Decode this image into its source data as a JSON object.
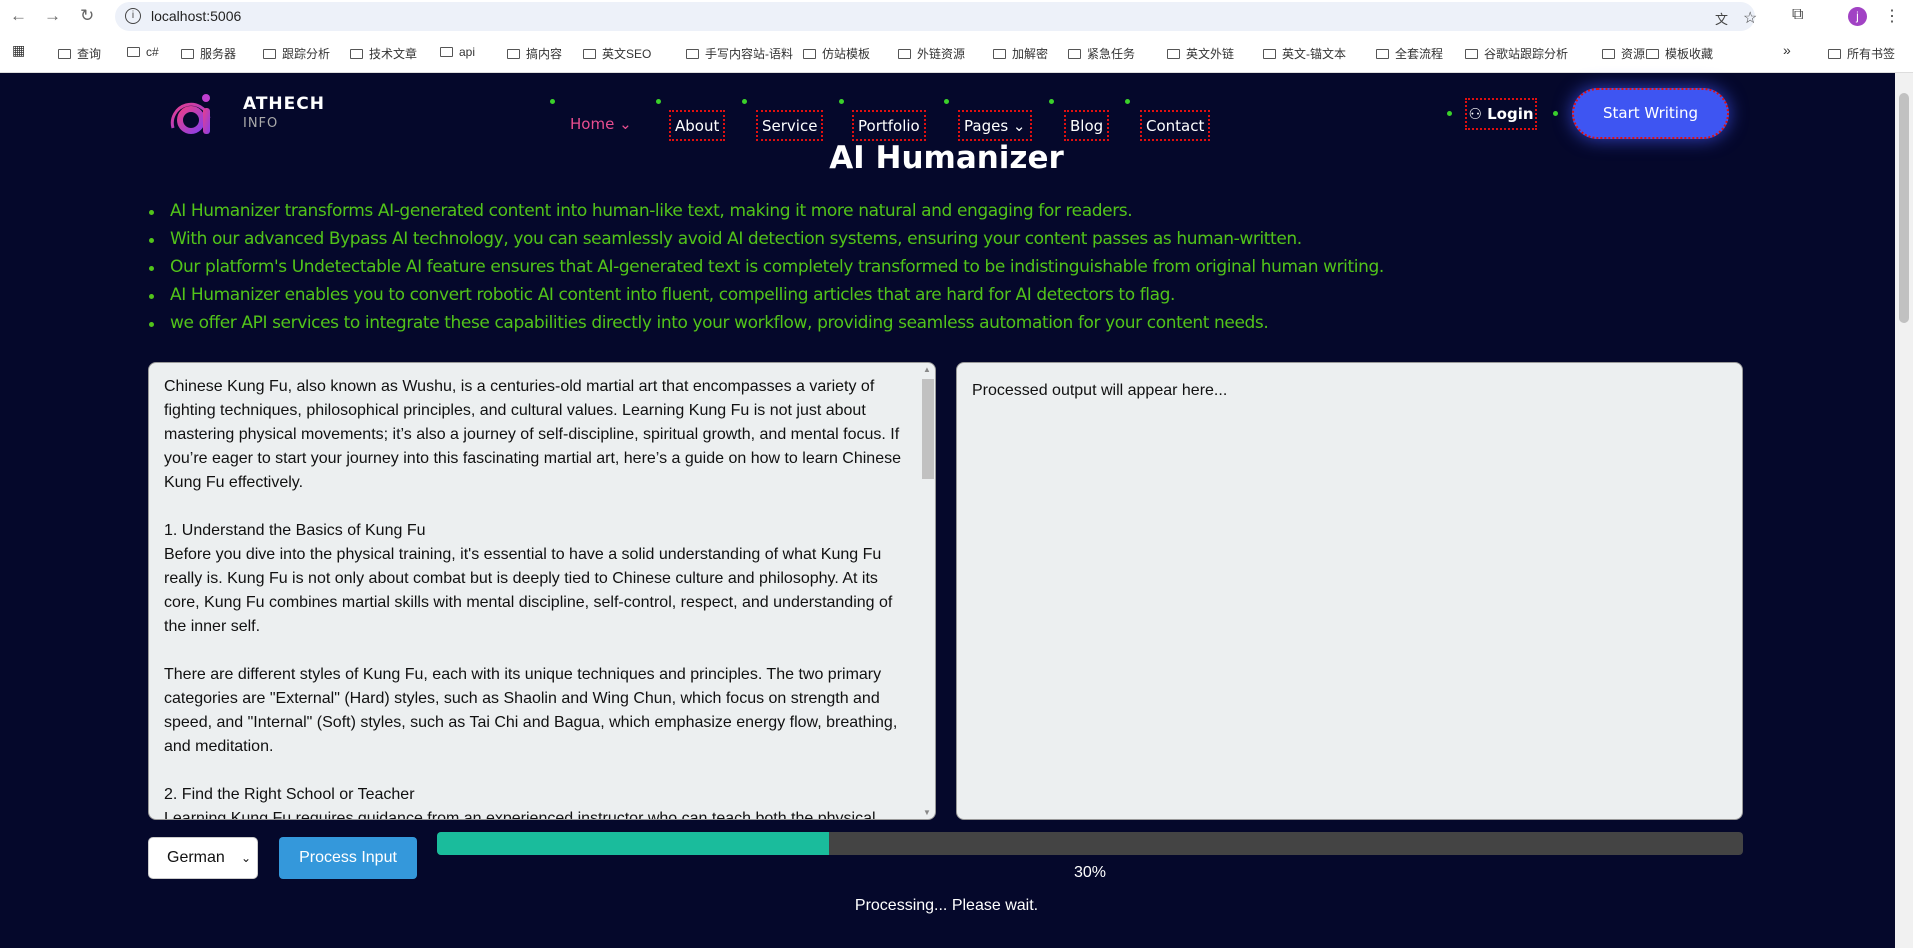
{
  "browser": {
    "url": "localhost:5006",
    "avatar_letter": "j",
    "bookmarks": [
      "查询",
      "c#",
      "服务器",
      "跟踪分析",
      "技术文章",
      "api",
      "搞内容",
      "英文SEO",
      "手写内容站-语料",
      "仿站模板",
      "外链资源",
      "加解密",
      "紧急任务",
      "英文外链",
      "英文-锚文本",
      "全套流程",
      "谷歌站跟踪分析",
      "资源",
      "模板收藏"
    ],
    "more": "»",
    "all_bookmarks": "所有书签"
  },
  "site": {
    "brand": "ATHECH",
    "brand_sub": "INFO",
    "nav": [
      "Home",
      "About",
      "Service",
      "Portfolio",
      "Pages",
      "Blog",
      "Contact"
    ],
    "login": "Login",
    "cta": "Start Writing"
  },
  "main": {
    "title": "AI Humanizer",
    "bullets": [
      "AI Humanizer transforms AI-generated content into human-like text, making it more natural and engaging for readers.",
      "With our advanced Bypass AI technology, you can seamlessly avoid AI detection systems, ensuring your content passes as human-written.",
      "Our platform's Undetectable AI feature ensures that AI-generated text is completely transformed to be indistinguishable from original human writing.",
      "AI Humanizer enables you to convert robotic AI content into fluent, compelling articles that are hard for AI detectors to flag.",
      "we offer API services to integrate these capabilities directly into your workflow, providing seamless automation for your content needs."
    ],
    "input_text": "Chinese Kung Fu, also known as Wushu, is a centuries-old martial art that encompasses a variety of fighting techniques, philosophical principles, and cultural values. Learning Kung Fu is not just about mastering physical movements; it’s also a journey of self-discipline, spiritual growth, and mental focus. If you’re eager to start your journey into this fascinating martial art, here’s a guide on how to learn Chinese Kung Fu effectively.\n\n1. Understand the Basics of Kung Fu\nBefore you dive into the physical training, it's essential to have a solid understanding of what Kung Fu really is. Kung Fu is not only about combat but is deeply tied to Chinese culture and philosophy. At its core, Kung Fu combines martial skills with mental discipline, self-control, respect, and understanding of the inner self.\n\nThere are different styles of Kung Fu, each with its unique techniques and principles. The two primary categories are \"External\" (Hard) styles, such as Shaolin and Wing Chun, which focus on strength and speed, and \"Internal\" (Soft) styles, such as Tai Chi and Bagua, which emphasize energy flow, breathing, and meditation.\n\n2. Find the Right School or Teacher\nLearning Kung Fu requires guidance from an experienced instructor who can teach both the physical",
    "output_placeholder": "Processed output will appear here...",
    "language": "German",
    "process_button": "Process Input",
    "progress_percent": 30,
    "progress_label": "30%",
    "status": "Processing... Please wait."
  },
  "colors": {
    "background": "#05082b",
    "bullet_text": "#52c41a",
    "progress_fill": "#1abc9c",
    "button": "#3498db",
    "cta": "#3e55f2",
    "nav_active": "#e94e8f"
  }
}
